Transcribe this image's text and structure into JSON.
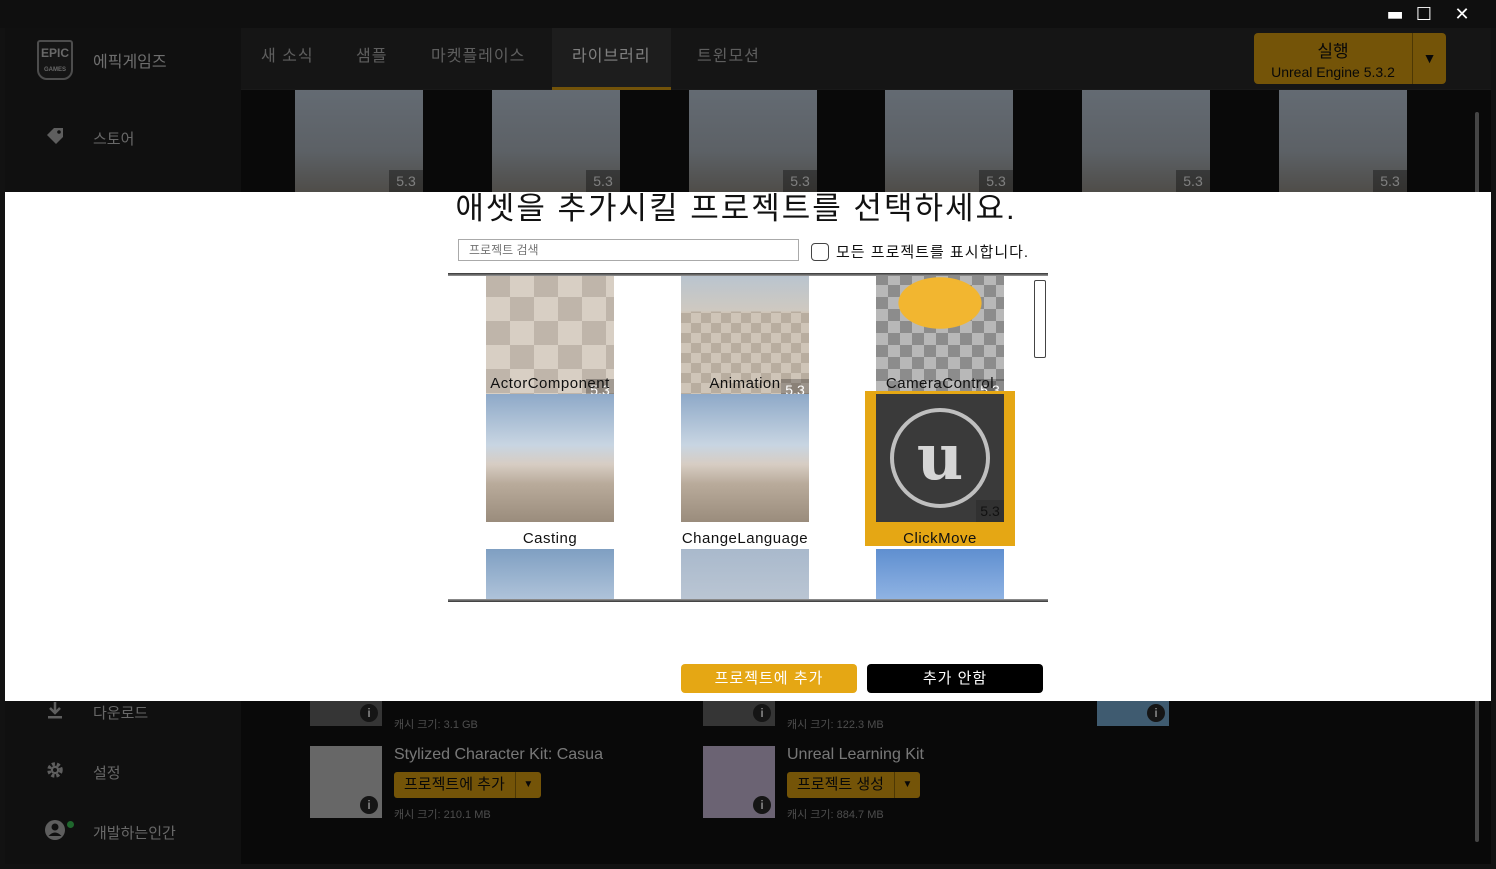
{
  "window": {
    "minimize": "▬",
    "maximize": "☐",
    "close": "✕"
  },
  "brand": {
    "logo_text": "EPIC\nGAMES",
    "name": "에픽게임즈"
  },
  "sidebar": {
    "items": [
      {
        "label": "스토어",
        "icon": "tag-icon"
      },
      {
        "label": "다운로드",
        "icon": "download-icon"
      },
      {
        "label": "설정",
        "icon": "gear-icon"
      },
      {
        "label": "개발하는인간",
        "icon": "user-icon"
      }
    ]
  },
  "nav": {
    "tabs": [
      {
        "label": "새 소식"
      },
      {
        "label": "샘플"
      },
      {
        "label": "마켓플레이스"
      },
      {
        "label": "라이브러리",
        "active": true
      },
      {
        "label": "트윈모션"
      }
    ]
  },
  "launch": {
    "label": "실행",
    "version": "Unreal Engine 5.3.2",
    "dropdown": "▼"
  },
  "background_thumbs": [
    "5.3",
    "5.3",
    "5.3",
    "5.3",
    "5.3",
    "5.3"
  ],
  "library": {
    "items": [
      {
        "title": "Stylized Character Kit: Casua",
        "button": "프로젝트에 추가",
        "cache": "캐시 크기: 210.1 MB"
      },
      {
        "title": "Unreal Learning Kit",
        "button": "프로젝트 생성",
        "cache": "캐시 크기: 884.7 MB"
      }
    ],
    "partial_cache": [
      "캐시 크기: 3.1 GB",
      "캐시 크기: 122.3 MB"
    ]
  },
  "modal": {
    "title": "애셋을 추가시킬 프로젝트를 선택하세요.",
    "search_placeholder": "프로젝트 검색",
    "show_all_label": "모든 프로젝트를 표시합니다.",
    "show_all_checked": false,
    "projects": [
      {
        "name": "ActorComponent",
        "version": "5.3",
        "selected": false
      },
      {
        "name": "Animation",
        "version": "5.3",
        "selected": false
      },
      {
        "name": "CameraControl",
        "version": "5.3",
        "selected": false
      },
      {
        "name": "Casting",
        "version": "",
        "selected": false
      },
      {
        "name": "ChangeLanguage",
        "version": "",
        "selected": false
      },
      {
        "name": "ClickMove",
        "version": "5.3",
        "selected": true
      }
    ],
    "add_button": "프로젝트에 추가",
    "cancel_button": "추가 안함"
  },
  "colors": {
    "accent": "#e5a714",
    "sidebar": "#202020",
    "topnav": "#2a2a2a"
  }
}
